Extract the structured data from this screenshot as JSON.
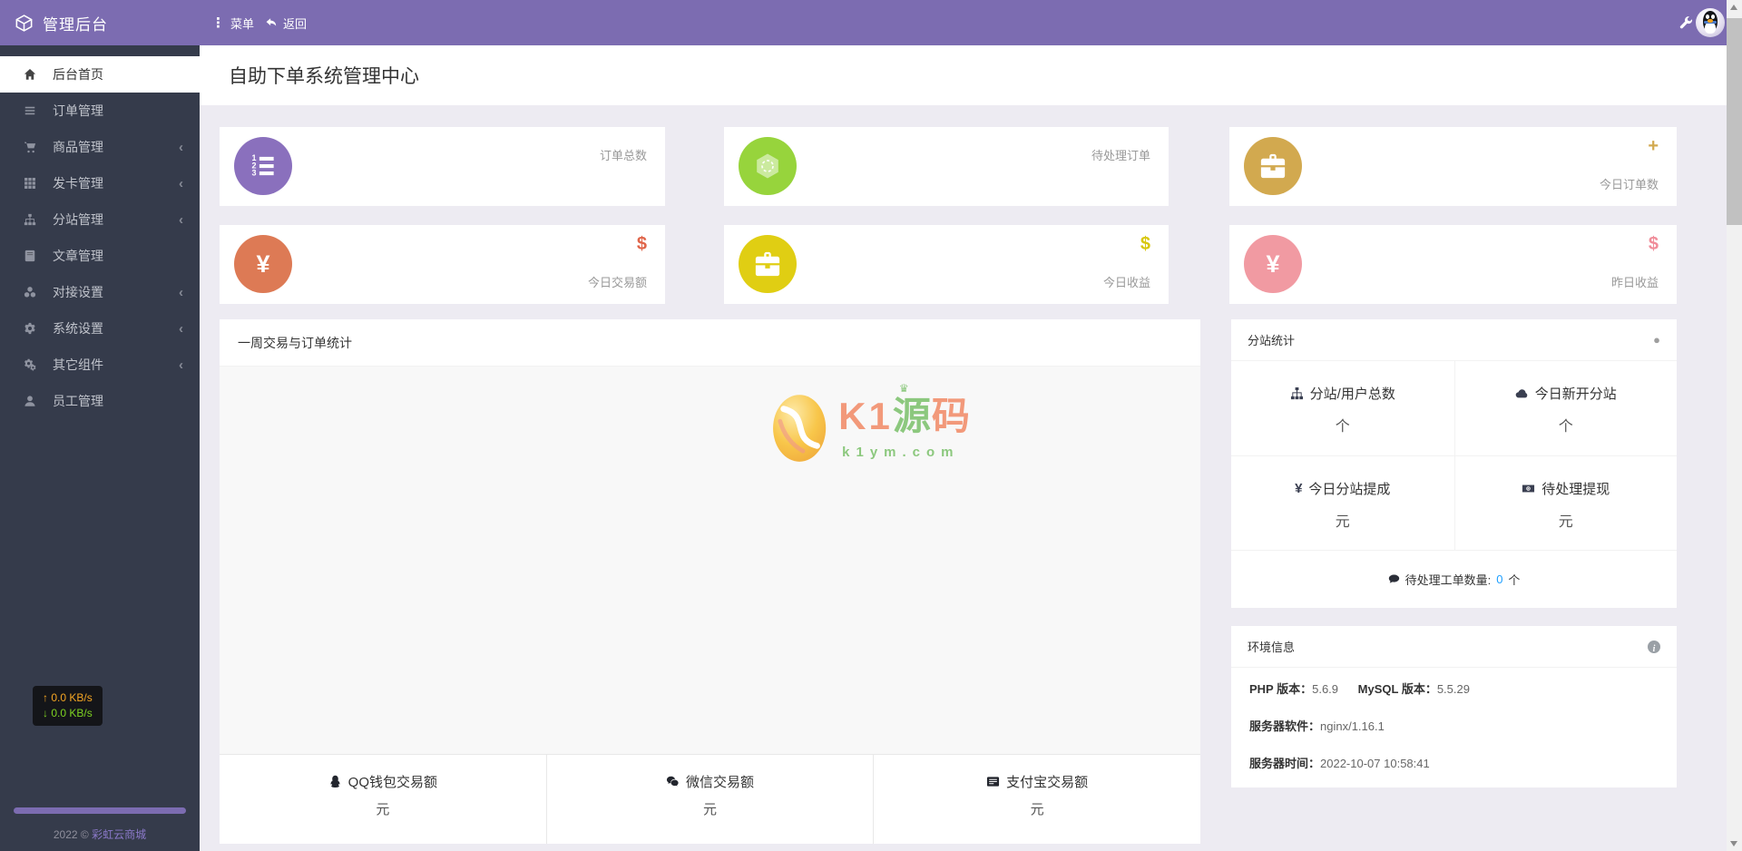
{
  "header": {
    "brand": "管理后台",
    "menu": "菜单",
    "back": "返回"
  },
  "sidebar": {
    "items": [
      {
        "label": "后台首页",
        "chevron": ""
      },
      {
        "label": "订单管理",
        "chevron": ""
      },
      {
        "label": "商品管理",
        "chevron": "‹"
      },
      {
        "label": "发卡管理",
        "chevron": "‹"
      },
      {
        "label": "分站管理",
        "chevron": "‹"
      },
      {
        "label": "文章管理",
        "chevron": ""
      },
      {
        "label": "对接设置",
        "chevron": "‹"
      },
      {
        "label": "系统设置",
        "chevron": "‹"
      },
      {
        "label": "其它组件",
        "chevron": "‹"
      },
      {
        "label": "员工管理",
        "chevron": ""
      }
    ],
    "speed_up": "↑ 0.0 KB/s",
    "speed_down": "↓ 0.0 KB/s",
    "footer_prefix": "2022 © ",
    "footer_link": "彩虹云商城"
  },
  "page": {
    "title": "自助下单系统管理中心"
  },
  "stat_cards": [
    {
      "label": "订单总数",
      "accent": "",
      "color": "#8a70bd",
      "accent_color": ""
    },
    {
      "label": "待处理订单",
      "accent": "",
      "color": "#97d43c",
      "accent_color": ""
    },
    {
      "label": "今日订单数",
      "accent": "+",
      "color": "#d2a94f",
      "accent_color": "#d2a94f"
    },
    {
      "label": "今日交易额",
      "accent": "$",
      "color": "#dd7a55",
      "accent_color": "#e0654a",
      "glyph": "¥"
    },
    {
      "label": "今日收益",
      "accent": "$",
      "color": "#e0ce13",
      "accent_color": "#d8c70f"
    },
    {
      "label": "昨日收益",
      "accent": "$",
      "color": "#f19aa2",
      "accent_color": "#f08d9a",
      "glyph": "¥"
    }
  ],
  "chart_panel": {
    "title": "一周交易与订单统计"
  },
  "payment_stats": [
    {
      "label": "QQ钱包交易额",
      "unit": "元"
    },
    {
      "label": "微信交易额",
      "unit": "元"
    },
    {
      "label": "支付宝交易额",
      "unit": "元"
    }
  ],
  "branch_panel": {
    "title": "分站统计",
    "cells": [
      {
        "label": "分站/用户总数",
        "value": "个"
      },
      {
        "label": "今日新开分站",
        "value": "个"
      },
      {
        "label": "今日分站提成",
        "value": "元",
        "icon_glyph": "¥"
      },
      {
        "label": "待处理提现",
        "value": "元"
      }
    ],
    "ticket_label": "待处理工单数量:",
    "ticket_value": "0",
    "ticket_unit": "个"
  },
  "env_panel": {
    "title": "环境信息",
    "rows": [
      {
        "label1": "PHP 版本：",
        "value1": "5.6.9",
        "label2": "MySQL 版本：",
        "value2": "5.5.29"
      },
      {
        "label1": "服务器软件：",
        "value1": "nginx/1.16.1"
      },
      {
        "label1": "服务器时间：",
        "value1": "2022-10-07 10:58:41"
      }
    ]
  },
  "watermark": {
    "latin": "K1",
    "cn_first": "源",
    "cn_second": "码",
    "domain": "k1ym.com"
  },
  "colors": {
    "header": "#7c6cb1",
    "sidebar": "#353b4b",
    "page_bg": "#edebf2",
    "link": "#8b79c9",
    "speed_up": "#f5a623",
    "speed_down": "#7ed321",
    "ticket_count": "#1e9fff"
  }
}
